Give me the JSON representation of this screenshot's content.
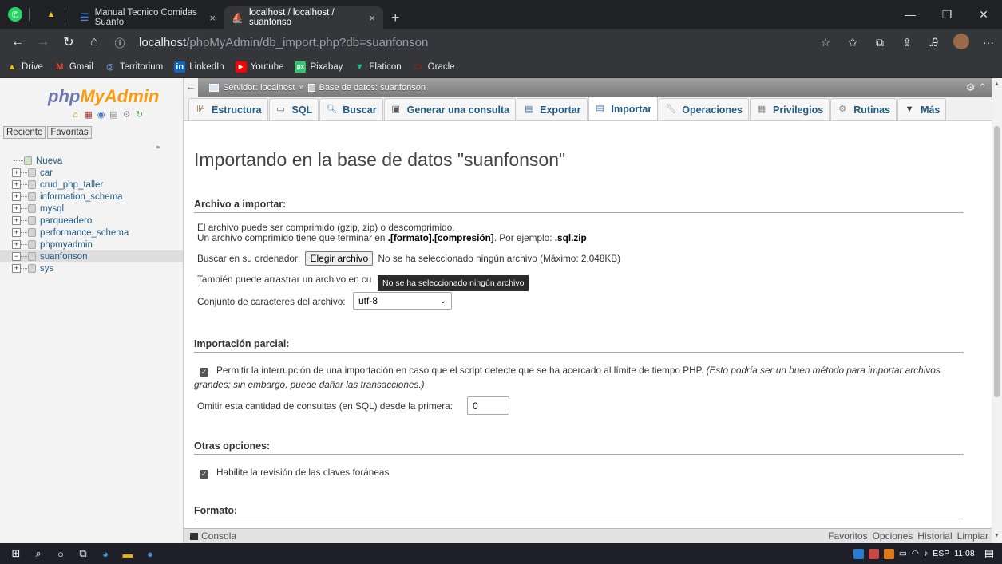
{
  "browser": {
    "tabs": [
      {
        "title": "Manual Tecnico Comidas Suanfo",
        "active": false
      },
      {
        "title": "localhost / localhost / suanfonso",
        "active": true
      }
    ],
    "new_tab": "+",
    "url_host": "localhost",
    "url_path": "/phpMyAdmin/db_import.php?db=suanfonson",
    "bookmarks": [
      "Drive",
      "Gmail",
      "Territorium",
      "LinkedIn",
      "Youtube",
      "Pixabay",
      "Flaticon",
      "Oracle"
    ]
  },
  "pma": {
    "logo_a": "php",
    "logo_b": "MyAdmin",
    "nav_tabs": [
      "Reciente",
      "Favoritas"
    ],
    "tree": [
      {
        "label": "Nueva"
      },
      {
        "label": "car"
      },
      {
        "label": "crud_php_taller"
      },
      {
        "label": "information_schema"
      },
      {
        "label": "mysql"
      },
      {
        "label": "parqueadero"
      },
      {
        "label": "performance_schema"
      },
      {
        "label": "phpmyadmin"
      },
      {
        "label": "suanfonson"
      },
      {
        "label": "sys"
      }
    ],
    "breadcrumb_server": "Servidor: localhost",
    "breadcrumb_sep": "»",
    "breadcrumb_db": "Base de datos: suanfonson",
    "menu": [
      {
        "label": "Estructura"
      },
      {
        "label": "SQL"
      },
      {
        "label": "Buscar"
      },
      {
        "label": "Generar una consulta"
      },
      {
        "label": "Exportar"
      },
      {
        "label": "Importar"
      },
      {
        "label": "Operaciones"
      },
      {
        "label": "Privilegios"
      },
      {
        "label": "Rutinas"
      },
      {
        "label": "Más"
      }
    ]
  },
  "page": {
    "title": "Importando en la base de datos \"suanfonson\"",
    "file_section": {
      "heading": "Archivo a importar:",
      "line1": "El archivo puede ser comprimido (gzip, zip) o descomprimido.",
      "line2_prefix": "Un archivo comprimido tiene que terminar en ",
      "line2_format": ".[formato].[compresión]",
      "line2_mid": ". Por ejemplo: ",
      "line2_example": ".sql.zip",
      "browse_label": "Buscar en su ordenador:",
      "choose_button": "Elegir archivo",
      "no_file": "No se ha seleccionado ningún archivo",
      "max_size": "(Máximo: 2,048KB)",
      "drag_text": "También puede arrastrar un archivo en cu",
      "tooltip": "No se ha seleccionado ningún archivo",
      "charset_label": "Conjunto de caracteres del archivo:",
      "charset_value": "utf-8"
    },
    "partial_section": {
      "heading": "Importación parcial:",
      "allow_interrupt": "Permitir la interrupción de una importación en caso que el script detecte que se ha acercado al límite de tiempo PHP.",
      "allow_interrupt_note1": "(Esto podría ser un buen método para importar archivos",
      "allow_interrupt_note2": "grandes; sin embargo, puede dañar las transacciones.)",
      "skip_label": "Omitir esta cantidad de consultas (en SQL) desde la primera:",
      "skip_value": "0"
    },
    "other_section": {
      "heading": "Otras opciones:",
      "fk_checks": "Habilite la revisión de las claves foráneas"
    },
    "format_section": {
      "heading": "Formato:"
    }
  },
  "console": {
    "label": "Consola",
    "links": [
      "Favoritos",
      "Opciones",
      "Historial",
      "Limpiar"
    ]
  },
  "taskbar": {
    "lang": "ESP",
    "time": "11:08"
  },
  "colors": {
    "pma_link": "#235a81",
    "logo_php": "#6c78af",
    "logo_myadmin": "#f89c0e"
  }
}
